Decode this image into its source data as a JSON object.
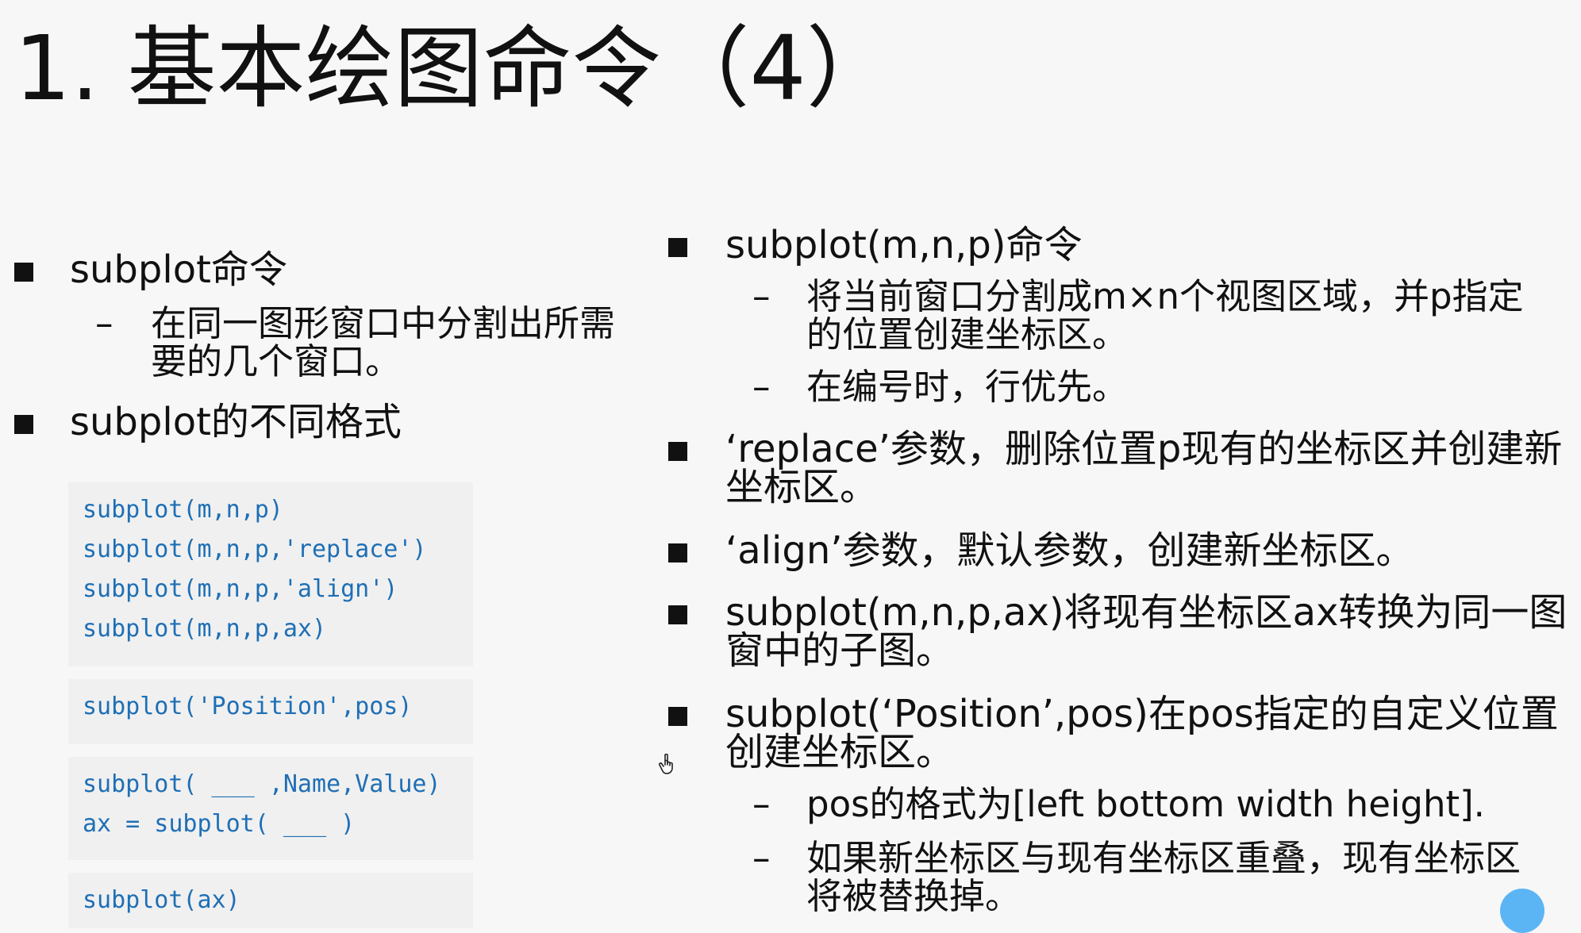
{
  "title": "1. 基本绘图命令（4）",
  "left": {
    "bullets": [
      {
        "label": "subplot命令",
        "subs": [
          "在同一图形窗口中分割出所需要的几个窗口。"
        ]
      },
      {
        "label": "subplot的不同格式",
        "subs": []
      }
    ],
    "code_blocks": [
      [
        "subplot(m,n,p)",
        "subplot(m,n,p,'replace')",
        "subplot(m,n,p,'align')",
        "subplot(m,n,p,ax)"
      ],
      [
        "subplot('Position',pos)"
      ],
      [
        "subplot( ___ ,Name,Value)",
        "ax = subplot( ___ )"
      ],
      [
        "subplot(ax)"
      ]
    ]
  },
  "right": {
    "bullets": [
      {
        "label": "subplot(m,n,p)命令",
        "subs": [
          "将当前窗口分割成m×n个视图区域，并p指定的位置创建坐标区。",
          "在编号时，行优先。"
        ]
      },
      {
        "label": "‘replace’参数，删除位置p现有的坐标区并创建新坐标区。",
        "subs": []
      },
      {
        "label": "‘align’参数，默认参数，创建新坐标区。",
        "subs": []
      },
      {
        "label": "subplot(m,n,p,ax)将现有坐标区ax转换为同一图窗中的子图。",
        "subs": []
      },
      {
        "label": "subplot(‘Position’,pos)在pos指定的自定义位置创建坐标区。",
        "subs": [
          "pos的格式为[left bottom width height].",
          "如果新坐标区与现有坐标区重叠，现有坐标区将被替换掉。"
        ]
      }
    ]
  },
  "colors": {
    "background": "#f7f7f7",
    "code_text": "#1e6fb5",
    "code_background": "#f0f0f0"
  },
  "icons": {
    "cursor": "hand-pointer-icon",
    "bullet": "square-bullet-icon"
  }
}
